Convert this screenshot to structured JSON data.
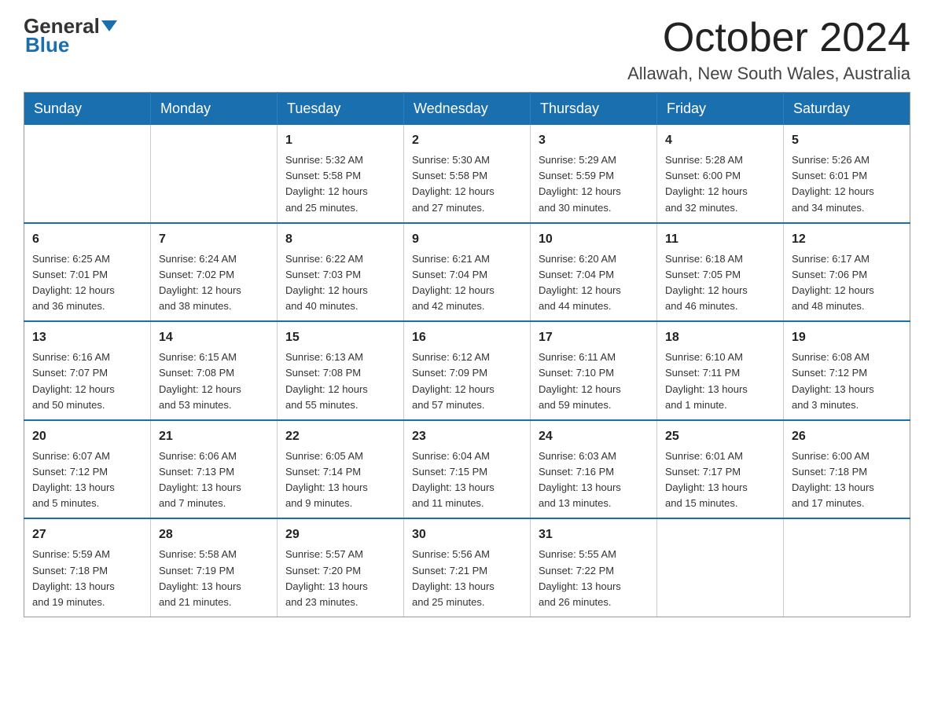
{
  "logo": {
    "part1": "General",
    "part2": "Blue"
  },
  "header": {
    "month": "October 2024",
    "location": "Allawah, New South Wales, Australia"
  },
  "weekdays": [
    "Sunday",
    "Monday",
    "Tuesday",
    "Wednesday",
    "Thursday",
    "Friday",
    "Saturday"
  ],
  "weeks": [
    [
      {
        "day": "",
        "info": ""
      },
      {
        "day": "",
        "info": ""
      },
      {
        "day": "1",
        "info": "Sunrise: 5:32 AM\nSunset: 5:58 PM\nDaylight: 12 hours\nand 25 minutes."
      },
      {
        "day": "2",
        "info": "Sunrise: 5:30 AM\nSunset: 5:58 PM\nDaylight: 12 hours\nand 27 minutes."
      },
      {
        "day": "3",
        "info": "Sunrise: 5:29 AM\nSunset: 5:59 PM\nDaylight: 12 hours\nand 30 minutes."
      },
      {
        "day": "4",
        "info": "Sunrise: 5:28 AM\nSunset: 6:00 PM\nDaylight: 12 hours\nand 32 minutes."
      },
      {
        "day": "5",
        "info": "Sunrise: 5:26 AM\nSunset: 6:01 PM\nDaylight: 12 hours\nand 34 minutes."
      }
    ],
    [
      {
        "day": "6",
        "info": "Sunrise: 6:25 AM\nSunset: 7:01 PM\nDaylight: 12 hours\nand 36 minutes."
      },
      {
        "day": "7",
        "info": "Sunrise: 6:24 AM\nSunset: 7:02 PM\nDaylight: 12 hours\nand 38 minutes."
      },
      {
        "day": "8",
        "info": "Sunrise: 6:22 AM\nSunset: 7:03 PM\nDaylight: 12 hours\nand 40 minutes."
      },
      {
        "day": "9",
        "info": "Sunrise: 6:21 AM\nSunset: 7:04 PM\nDaylight: 12 hours\nand 42 minutes."
      },
      {
        "day": "10",
        "info": "Sunrise: 6:20 AM\nSunset: 7:04 PM\nDaylight: 12 hours\nand 44 minutes."
      },
      {
        "day": "11",
        "info": "Sunrise: 6:18 AM\nSunset: 7:05 PM\nDaylight: 12 hours\nand 46 minutes."
      },
      {
        "day": "12",
        "info": "Sunrise: 6:17 AM\nSunset: 7:06 PM\nDaylight: 12 hours\nand 48 minutes."
      }
    ],
    [
      {
        "day": "13",
        "info": "Sunrise: 6:16 AM\nSunset: 7:07 PM\nDaylight: 12 hours\nand 50 minutes."
      },
      {
        "day": "14",
        "info": "Sunrise: 6:15 AM\nSunset: 7:08 PM\nDaylight: 12 hours\nand 53 minutes."
      },
      {
        "day": "15",
        "info": "Sunrise: 6:13 AM\nSunset: 7:08 PM\nDaylight: 12 hours\nand 55 minutes."
      },
      {
        "day": "16",
        "info": "Sunrise: 6:12 AM\nSunset: 7:09 PM\nDaylight: 12 hours\nand 57 minutes."
      },
      {
        "day": "17",
        "info": "Sunrise: 6:11 AM\nSunset: 7:10 PM\nDaylight: 12 hours\nand 59 minutes."
      },
      {
        "day": "18",
        "info": "Sunrise: 6:10 AM\nSunset: 7:11 PM\nDaylight: 13 hours\nand 1 minute."
      },
      {
        "day": "19",
        "info": "Sunrise: 6:08 AM\nSunset: 7:12 PM\nDaylight: 13 hours\nand 3 minutes."
      }
    ],
    [
      {
        "day": "20",
        "info": "Sunrise: 6:07 AM\nSunset: 7:12 PM\nDaylight: 13 hours\nand 5 minutes."
      },
      {
        "day": "21",
        "info": "Sunrise: 6:06 AM\nSunset: 7:13 PM\nDaylight: 13 hours\nand 7 minutes."
      },
      {
        "day": "22",
        "info": "Sunrise: 6:05 AM\nSunset: 7:14 PM\nDaylight: 13 hours\nand 9 minutes."
      },
      {
        "day": "23",
        "info": "Sunrise: 6:04 AM\nSunset: 7:15 PM\nDaylight: 13 hours\nand 11 minutes."
      },
      {
        "day": "24",
        "info": "Sunrise: 6:03 AM\nSunset: 7:16 PM\nDaylight: 13 hours\nand 13 minutes."
      },
      {
        "day": "25",
        "info": "Sunrise: 6:01 AM\nSunset: 7:17 PM\nDaylight: 13 hours\nand 15 minutes."
      },
      {
        "day": "26",
        "info": "Sunrise: 6:00 AM\nSunset: 7:18 PM\nDaylight: 13 hours\nand 17 minutes."
      }
    ],
    [
      {
        "day": "27",
        "info": "Sunrise: 5:59 AM\nSunset: 7:18 PM\nDaylight: 13 hours\nand 19 minutes."
      },
      {
        "day": "28",
        "info": "Sunrise: 5:58 AM\nSunset: 7:19 PM\nDaylight: 13 hours\nand 21 minutes."
      },
      {
        "day": "29",
        "info": "Sunrise: 5:57 AM\nSunset: 7:20 PM\nDaylight: 13 hours\nand 23 minutes."
      },
      {
        "day": "30",
        "info": "Sunrise: 5:56 AM\nSunset: 7:21 PM\nDaylight: 13 hours\nand 25 minutes."
      },
      {
        "day": "31",
        "info": "Sunrise: 5:55 AM\nSunset: 7:22 PM\nDaylight: 13 hours\nand 26 minutes."
      },
      {
        "day": "",
        "info": ""
      },
      {
        "day": "",
        "info": ""
      }
    ]
  ]
}
